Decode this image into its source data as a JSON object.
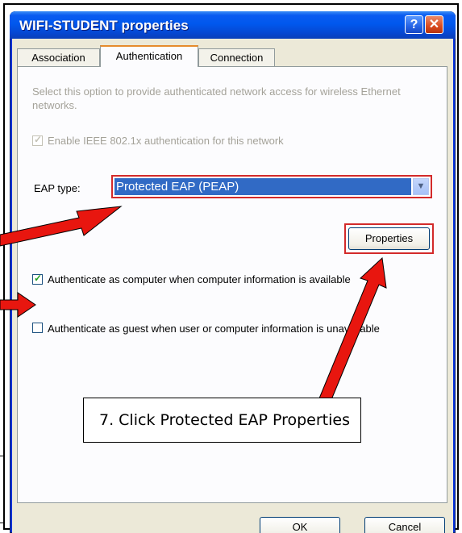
{
  "window": {
    "title": "WIFI-STUDENT properties",
    "help_icon": "help-icon",
    "close_icon": "close-icon"
  },
  "tabs": [
    {
      "label": "Association"
    },
    {
      "label": "Authentication"
    },
    {
      "label": "Connection"
    }
  ],
  "authentication": {
    "description": "Select this option to provide authenticated network access for wireless Ethernet networks.",
    "enable_8021x": {
      "label": "Enable IEEE 802.1x authentication for this network",
      "checked": true,
      "enabled": false
    },
    "eap_type": {
      "label": "EAP type:",
      "value": "Protected EAP (PEAP)"
    },
    "properties_button": "Properties",
    "auth_computer": {
      "label": "Authenticate as computer when computer information is available",
      "checked": true
    },
    "auth_guest": {
      "label": "Authenticate as guest when user or computer information is unavailable",
      "checked": false
    }
  },
  "footer": {
    "ok": "OK",
    "cancel": "Cancel"
  },
  "callout": {
    "text": "7. Click Protected EAP Properties"
  },
  "colors": {
    "highlight": "#d32a2a",
    "selection": "#316ac5",
    "titlebar": "#0058ee"
  }
}
